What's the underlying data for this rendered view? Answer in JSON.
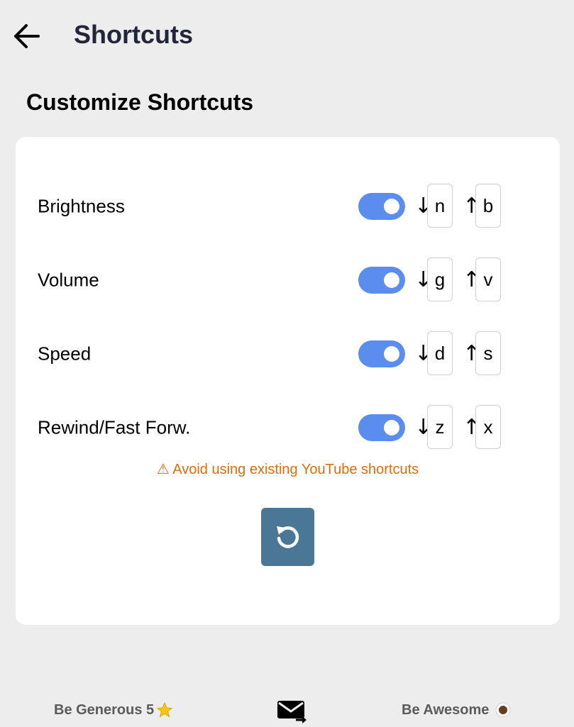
{
  "header": {
    "title": "Shortcuts",
    "back_icon": "arrow-left-icon"
  },
  "section_title": "Customize Shortcuts",
  "shortcuts": [
    {
      "label": "Brightness",
      "enabled": true,
      "down_arrow": "↓",
      "down_key": "n",
      "up_arrow": "↑",
      "up_key": "b"
    },
    {
      "label": "Volume",
      "enabled": true,
      "down_arrow": "↓",
      "down_key": "g",
      "up_arrow": "↑",
      "up_key": "v"
    },
    {
      "label": "Speed",
      "enabled": true,
      "down_arrow": "↓",
      "down_key": "d",
      "up_arrow": "↑",
      "up_key": "s"
    },
    {
      "label": "Rewind/Fast Forw.",
      "enabled": true,
      "down_arrow": "↓",
      "down_key": "z",
      "up_arrow": "↑",
      "up_key": "x"
    }
  ],
  "warning": "⚠ Avoid using existing YouTube shortcuts",
  "reset_icon": "reset-icon",
  "footer": {
    "left_label": "Be Generous 5",
    "left_icon": "star-icon",
    "middle_icon": "mail-forward-icon",
    "right_label": "Be Awesome",
    "right_icon": "coffee-icon"
  },
  "colors": {
    "background": "#ededed",
    "card": "#ffffff",
    "toggle_on": "#5b8def",
    "warning": "#e36c0a",
    "reset_button": "#4a7796",
    "footer_text": "#5b5b5b",
    "title_text": "#23263a"
  }
}
